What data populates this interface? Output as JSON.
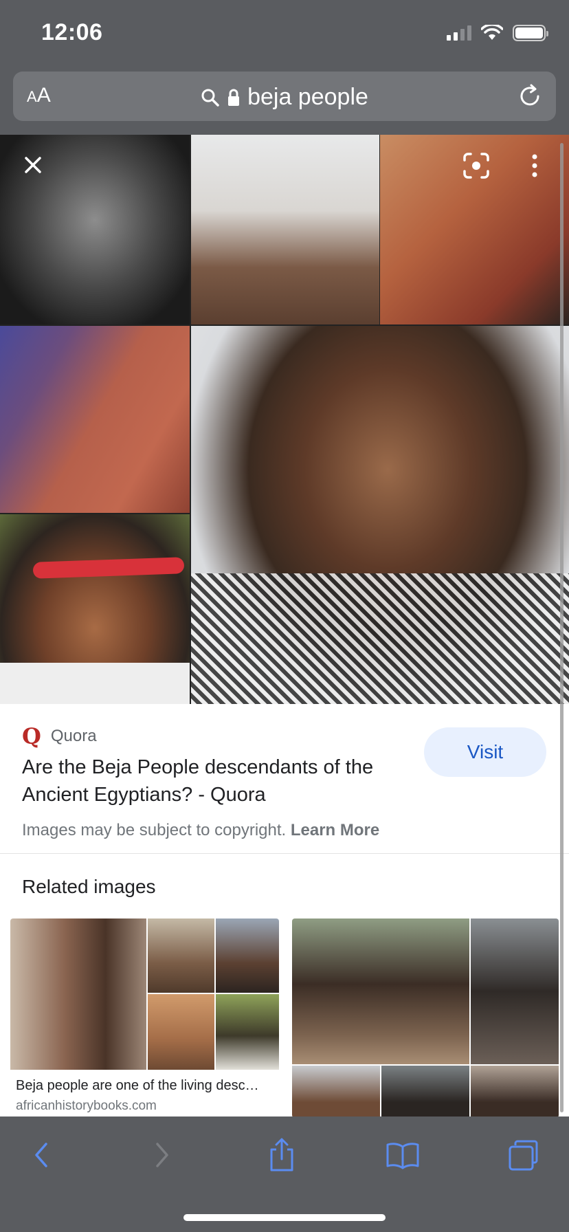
{
  "status": {
    "time": "12:06"
  },
  "browser": {
    "text_size_label": "AA",
    "url_text": "beja people"
  },
  "result": {
    "source": "Quora",
    "title": "Are the Beja People descendants of the Ancient Egyptians? - Quora",
    "visit_label": "Visit",
    "copyright_text": "Images may be subject to copyright.",
    "learn_more_label": "Learn More"
  },
  "related": {
    "heading": "Related images",
    "items": [
      {
        "caption": "Beja people are one of the living desc…",
        "source": "africanhistorybooks.com"
      }
    ]
  },
  "colors": {
    "chrome": "#5a5c60",
    "accent_blue": "#1a57c4",
    "visit_bg": "#e8f0fe",
    "quora_red": "#b92b27"
  },
  "icons": [
    "search-icon",
    "lock-icon",
    "reload-icon",
    "close-icon",
    "lens-icon",
    "more-vert-icon",
    "back-icon",
    "forward-icon",
    "share-icon",
    "bookmarks-icon",
    "tabs-icon"
  ]
}
